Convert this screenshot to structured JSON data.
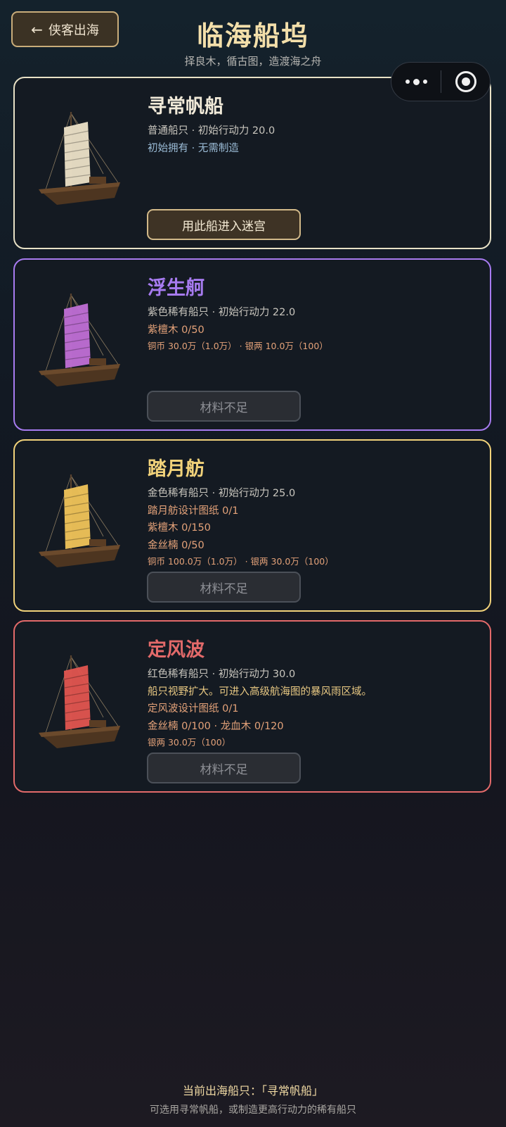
{
  "header": {
    "back_label": "侠客出海",
    "back_icon": "left-arrow-icon",
    "title": "临海船坞",
    "subtitle": "择良木，循古图，造渡海之舟"
  },
  "capsule": {
    "more_icon": "more-dots-icon",
    "close_icon": "target-circle-icon"
  },
  "ships": [
    {
      "name": "寻常帆船",
      "accent": "#e8e1c6",
      "sail_color": "#ece1c8",
      "lines": [
        {
          "text": "普通船只 · 初始行动力 20.0",
          "style": "grey"
        },
        {
          "text": "初始拥有 · 无需制造",
          "style": "blue"
        }
      ],
      "action": "用此船进入迷宫",
      "action_state": "enabled"
    },
    {
      "name": "浮生舸",
      "accent": "#a77bf0",
      "sail_color": "#c06fd6",
      "lines": [
        {
          "text": "紫色稀有船只 · 初始行动力 22.0",
          "style": "grey"
        },
        {
          "text": "紫檀木  0/50",
          "style": "orange"
        },
        {
          "text": "铜币 30.0万（1.0万） · 银两 10.0万（100）",
          "style": "orange small"
        }
      ],
      "action": "材料不足",
      "action_state": "disabled"
    },
    {
      "name": "踏月舫",
      "accent": "#f1d27a",
      "sail_color": "#f0c45a",
      "lines": [
        {
          "text": "金色稀有船只 · 初始行动力 25.0",
          "style": "grey"
        },
        {
          "text": "踏月舫设计图纸  0/1",
          "style": "orange"
        },
        {
          "text": "紫檀木  0/150",
          "style": "orange"
        },
        {
          "text": "金丝楠  0/50",
          "style": "orange"
        },
        {
          "text": "铜币 100.0万（1.0万） · 银两 30.0万（100）",
          "style": "orange small"
        }
      ],
      "action": "材料不足",
      "action_state": "disabled"
    },
    {
      "name": "定风波",
      "accent": "#e36a6a",
      "sail_color": "#e25550",
      "lines": [
        {
          "text": "红色稀有船只 · 初始行动力 30.0",
          "style": "grey"
        },
        {
          "text": "船只视野扩大。可进入高级航海图的暴风雨区域。",
          "style": "yellow"
        },
        {
          "text": "定风波设计图纸  0/1",
          "style": "orange"
        },
        {
          "text": "金丝楠 0/100 · 龙血木 0/120",
          "style": "orange"
        },
        {
          "text": "银两 30.0万（100）",
          "style": "orange small"
        }
      ],
      "action": "材料不足",
      "action_state": "disabled"
    }
  ],
  "footer": {
    "current_label": "当前出海船只：「寻常帆船」",
    "hint": "可选用寻常帆船，或制造更高行动力的稀有船只"
  }
}
